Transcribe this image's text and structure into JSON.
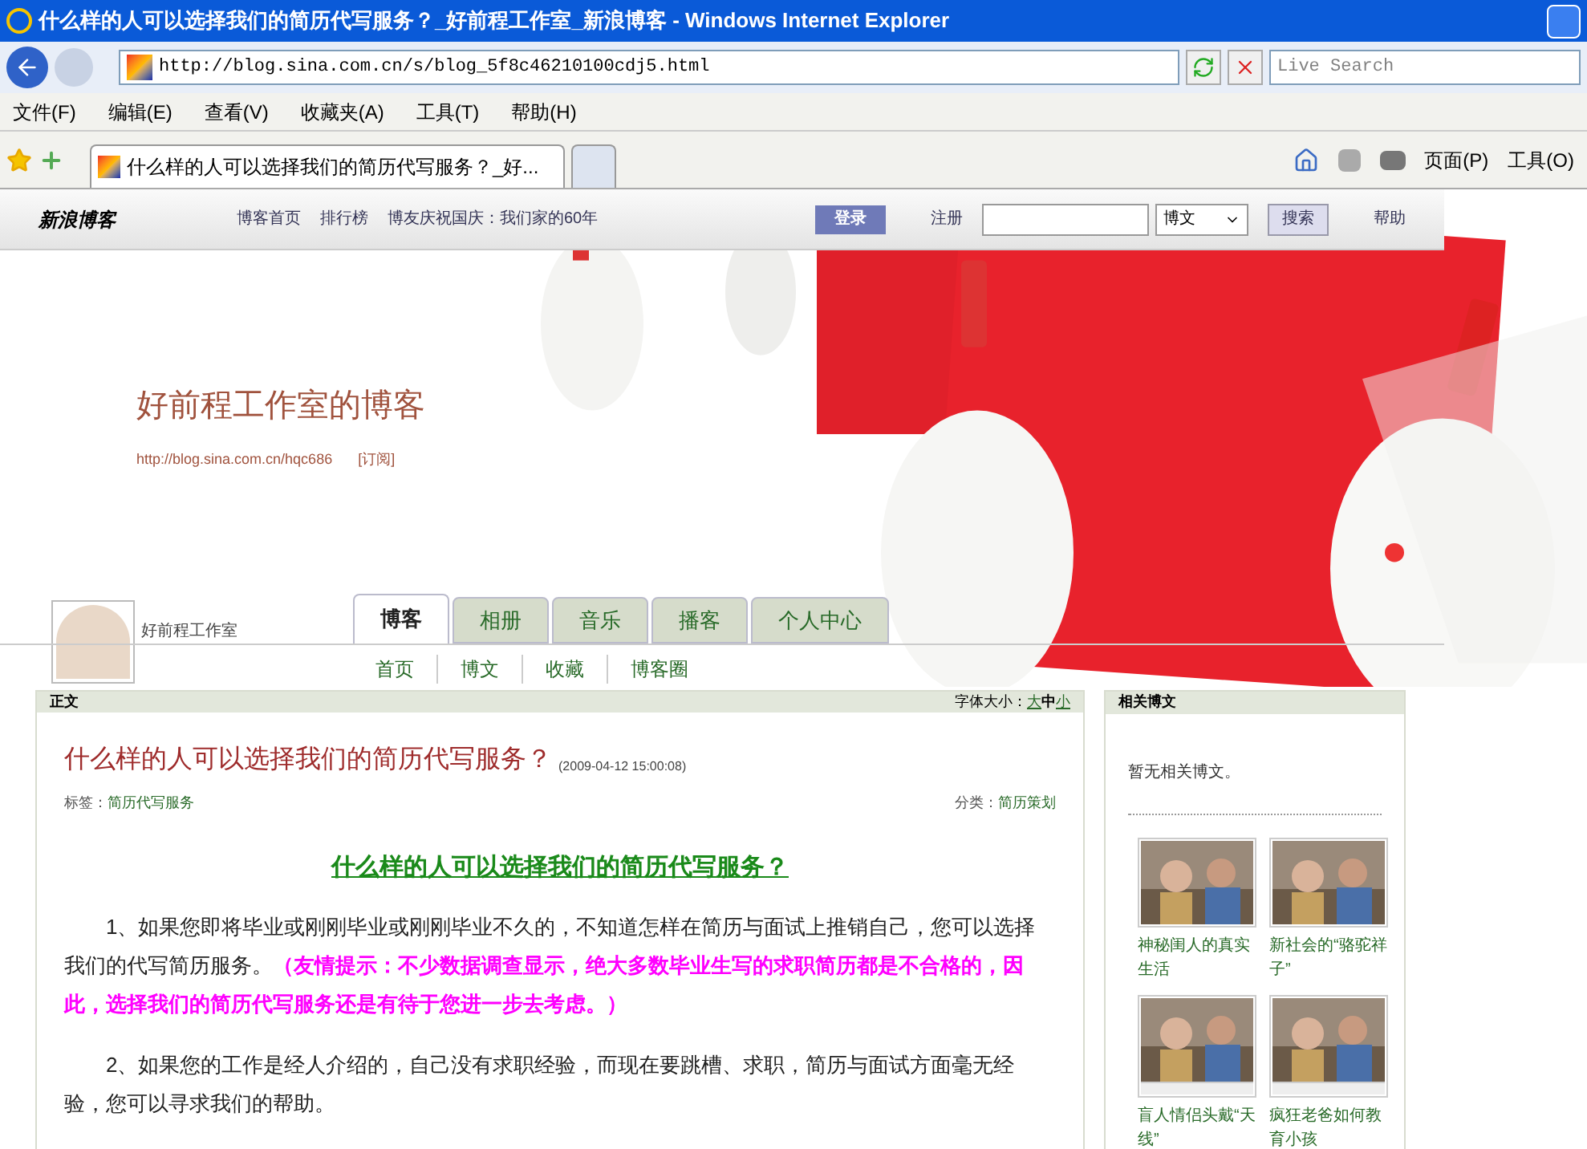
{
  "window": {
    "title": "什么样的人可以选择我们的简历代写服务？_好前程工作室_新浪博客 - Windows Internet Explorer"
  },
  "address_bar": {
    "url": "http://blog.sina.com.cn/s/blog_5f8c46210100cdj5.html"
  },
  "search": {
    "placeholder": "Live Search"
  },
  "menu": [
    "文件(F)",
    "编辑(E)",
    "查看(V)",
    "收藏夹(A)",
    "工具(T)",
    "帮助(H)"
  ],
  "browser_tabs": [
    {
      "label": "什么样的人可以选择我们的简历代写服务？_好...",
      "selected": true
    },
    {
      "selected": false
    }
  ],
  "command_bar": {
    "page": "页面(P)",
    "tools": "工具(O)"
  },
  "site_bar": {
    "logo": "新浪博客",
    "links": [
      "博客首页",
      "排行榜",
      "博友庆祝国庆：我们家的60年"
    ],
    "login": "登录",
    "register": "注册",
    "search_scope": "博文",
    "search_button": "搜索",
    "help": "帮助"
  },
  "blog": {
    "title": "好前程工作室的博客",
    "url": "http://blog.sina.com.cn/hqc686",
    "subscribe": "[订阅]",
    "owner": "好前程工作室"
  },
  "blog_tabs": [
    {
      "label": "博客",
      "selected": true
    },
    {
      "label": "相册",
      "selected": false
    },
    {
      "label": "音乐",
      "selected": false
    },
    {
      "label": "播客",
      "selected": false
    },
    {
      "label": "个人中心",
      "selected": false
    }
  ],
  "sub_nav": [
    "首页",
    "博文",
    "收藏",
    "博客圈"
  ],
  "article": {
    "section": "正文",
    "font_size_label": "字体大小：",
    "font_sizes": [
      {
        "label": "大",
        "selected": false
      },
      {
        "label": "中",
        "selected": true
      },
      {
        "label": "小",
        "selected": false
      }
    ],
    "title": "什么样的人可以选择我们的简历代写服务？",
    "date": "(2009-04-12 15:00:08)",
    "tags_label": "标签：",
    "tag": "简历代写服务",
    "category_label": "分类：",
    "category": "简历策划",
    "heading": "什么样的人可以选择我们的简历代写服务？",
    "paragraphs": [
      {
        "text": "1、如果您即将毕业或刚刚毕业或刚刚毕业不久的，不知道怎样在简历与面试上推销自己，您可以选择我们的代写简历服务。",
        "highlight": "（友情提示：不少数据调查显示，绝大多数毕业生写的求职简历都是不合格的，因此，选择我们的简历代写服务还是有待于您进一步去考虑。）"
      },
      {
        "text": "2、如果您的工作是经人介绍的，自己没有求职经验，而现在要跳槽、求职，简历与面试方面毫无经验，您可以寻求我们的帮助。"
      }
    ]
  },
  "related": {
    "title": "相关博文",
    "empty": "暂无相关博文。",
    "videos": [
      {
        "caption": "神秘闺人的真实生活",
        "kind": "picture"
      },
      {
        "caption": "新社会的“骆驼祥子”",
        "kind": "picture"
      },
      {
        "caption": "盲人情侣头戴“天线”",
        "kind": "video"
      },
      {
        "caption": "疯狂老爸如何教育小孩",
        "kind": "video"
      }
    ]
  }
}
